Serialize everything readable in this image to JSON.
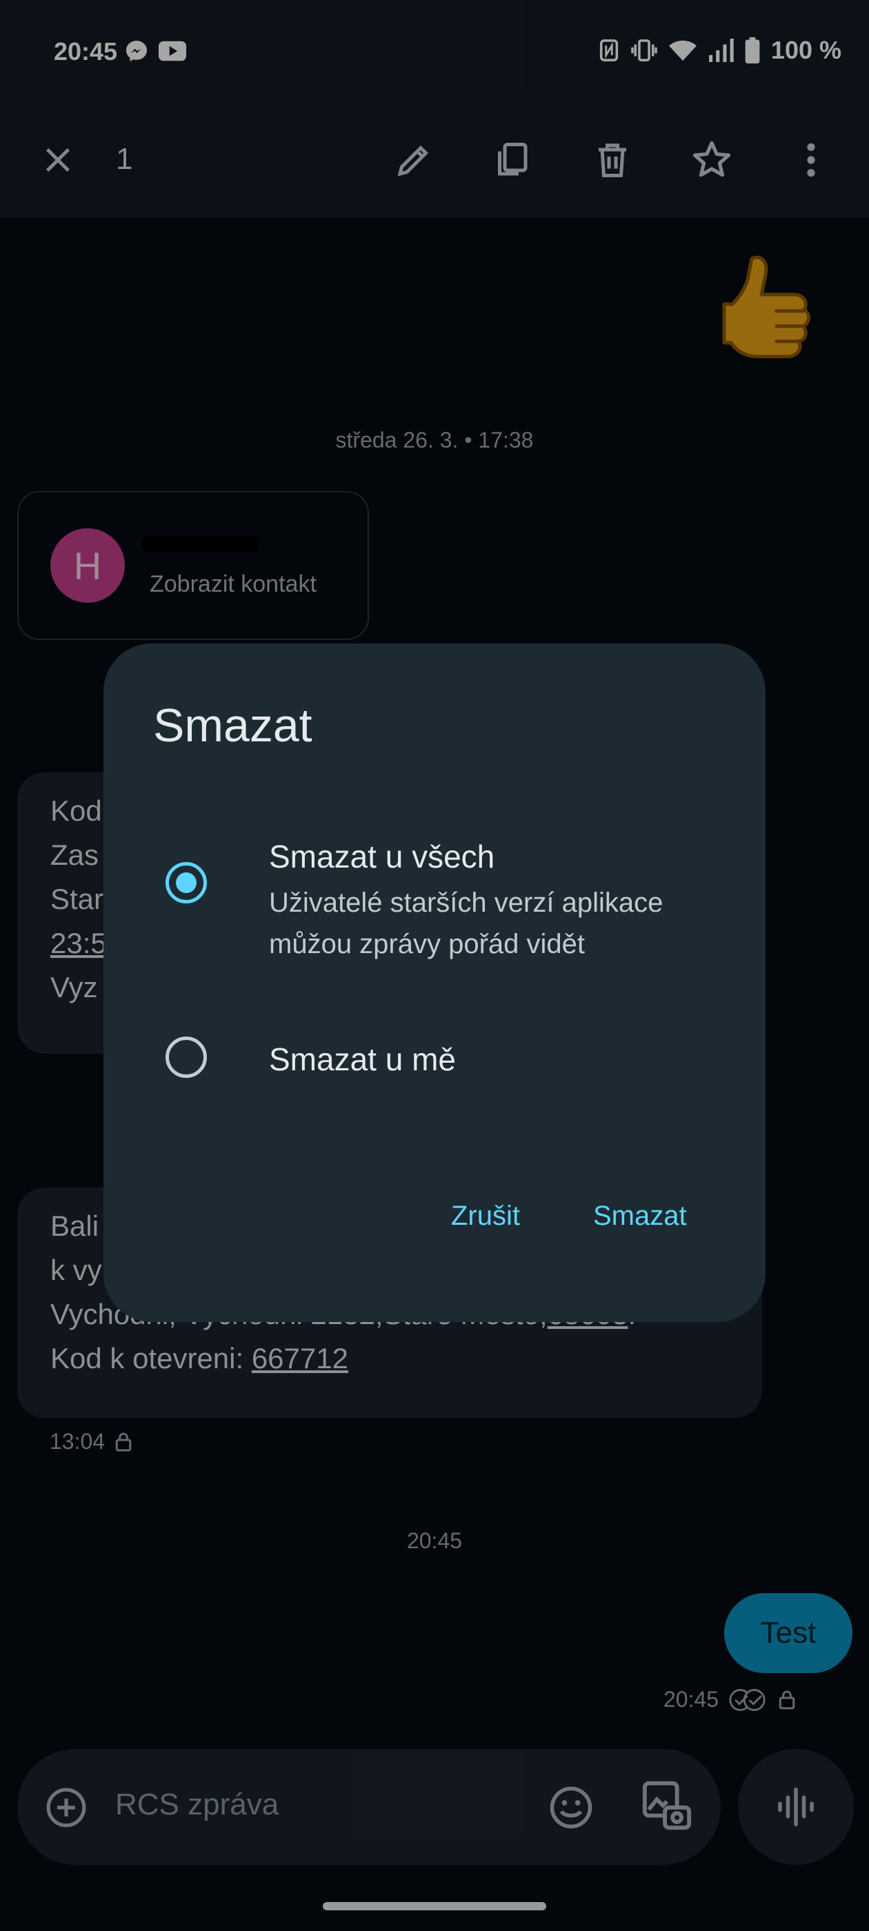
{
  "status_bar": {
    "time": "20:45",
    "battery_text": "100 %",
    "left_icons": [
      "messenger-icon",
      "youtube-icon"
    ],
    "right_icons": [
      "nfc-icon",
      "vibrate-icon",
      "wifi-icon",
      "signal-icon",
      "battery-icon"
    ]
  },
  "action_bar": {
    "selected_count": "1",
    "actions": [
      "close-icon",
      "edit-icon",
      "copy-icon",
      "delete-icon",
      "star-icon",
      "more-icon"
    ]
  },
  "chat": {
    "reaction_emoji": "👍",
    "date_separator_1": "středa 26. 3. • 17:38",
    "contact_card": {
      "avatar_letter": "H",
      "link": "Zobrazit kontakt"
    },
    "message_1": {
      "lines": [
        "Kod",
        "Zas",
        "Star",
        "23:5",
        "Vyz"
      ]
    },
    "message_2": {
      "line_1": "Bali",
      "line_2": "k vy",
      "line_3_prefix": "Vychodni, Vychodni 2132,Stare Mesto,",
      "line_3_link": "68603",
      "line_3_suffix": ".",
      "line_4_prefix": "Kod k otevreni: ",
      "line_4_link": "667712",
      "time": "13:04"
    },
    "date_separator_2": "20:45",
    "sent_message": {
      "text": "Test",
      "time": "20:45"
    }
  },
  "composer": {
    "placeholder": "RCS zpráva"
  },
  "dialog": {
    "title": "Smazat",
    "options": [
      {
        "title": "Smazat u všech",
        "description_line_1": "Uživatelé starších verzí aplikace",
        "description_line_2": "můžou zprávy pořád vidět",
        "selected": true
      },
      {
        "title": "Smazat u mě",
        "selected": false
      }
    ],
    "cancel_label": "Zrušit",
    "confirm_label": "Smazat"
  },
  "colors": {
    "accent": "#5fd4ff",
    "sent_bubble": "#0b8fbf",
    "dialog_bg": "#1d2a31",
    "avatar": "#c2408a"
  }
}
